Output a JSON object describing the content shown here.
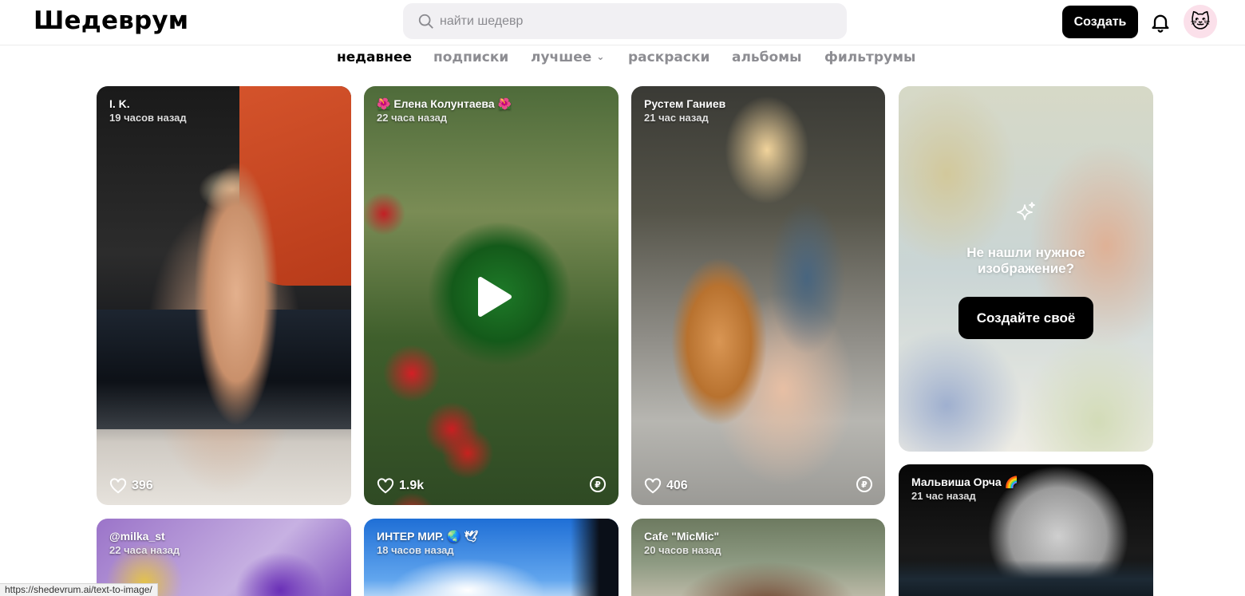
{
  "header": {
    "logo": "Шедеврум",
    "search_placeholder": "найти шедевр",
    "create_label": "Создать",
    "avatar_emoji": "🐱"
  },
  "tabs": [
    {
      "label": "недавнее",
      "active": true
    },
    {
      "label": "подписки",
      "active": false
    },
    {
      "label": "лучшее",
      "active": false,
      "has_dropdown": true
    },
    {
      "label": "раскраски",
      "active": false
    },
    {
      "label": "альбомы",
      "active": false
    },
    {
      "label": "фильтрумы",
      "active": false
    }
  ],
  "cards": [
    {
      "author": "I. K.",
      "time": "19 часов назад",
      "likes": "396",
      "video": false,
      "coin": false
    },
    {
      "author": "🌺 Елена Колунтаева 🌺",
      "time": "22 часа назад",
      "likes": "1.9k",
      "video": true,
      "coin": true
    },
    {
      "author": "Рустем Ганиев",
      "time": "21 час назад",
      "likes": "406",
      "video": false,
      "coin": true
    },
    {
      "author": "@milka_st",
      "time": "22 часа назад"
    },
    {
      "author": "ИНТЕР МИР. 🌏 🕊",
      "time": "18 часов назад"
    },
    {
      "author": "Cafe \"MicMic\"",
      "time": "20 часов назад"
    },
    {
      "author": "Мальвиша Орча 🌈",
      "time": "21 час назад"
    }
  ],
  "cta": {
    "text_line1": "Не нашли нужное",
    "text_line2": "изображение?",
    "button_label": "Создайте своё"
  },
  "coin_symbol": "₽",
  "status_url": "https://shedevrum.ai/text-to-image/",
  "colors": {
    "accent": "#000000",
    "tab_inactive": "#8d8d92",
    "search_bg": "#f1f0f3",
    "avatar_bg": "#fbe0ea"
  }
}
